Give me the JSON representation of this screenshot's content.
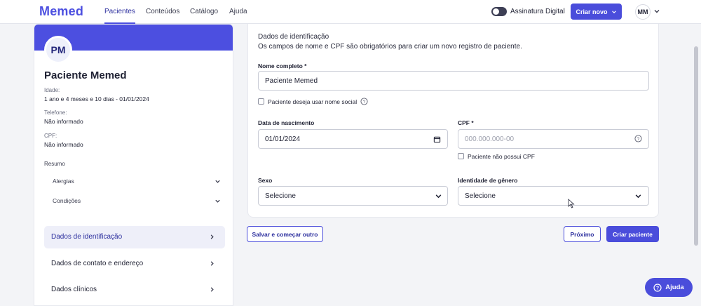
{
  "brand": {
    "logo_text": "Memed"
  },
  "nav": {
    "tabs": [
      {
        "label": "Pacientes",
        "active": true
      },
      {
        "label": "Conteúdos",
        "active": false
      },
      {
        "label": "Catálogo",
        "active": false
      },
      {
        "label": "Ajuda",
        "active": false
      }
    ]
  },
  "header": {
    "signature_label": "Assinatura Digital",
    "create_new_label": "Criar novo",
    "user_initials": "MM"
  },
  "patient": {
    "initials": "PM",
    "name": "Paciente Memed",
    "age_label": "Idade:",
    "age_value": "1 ano e 4 meses e 10 dias - 01/01/2024",
    "phone_label": "Telefone:",
    "phone_value": "Não informado",
    "cpf_label": "CPF:",
    "cpf_value": "Não informado",
    "summary_label": "Resumo",
    "summary_items": [
      "Alergias",
      "Condições"
    ]
  },
  "sidebar": {
    "items": [
      {
        "label": "Dados de identificação",
        "active": true
      },
      {
        "label": "Dados de contato e endereço",
        "active": false
      },
      {
        "label": "Dados clínicos",
        "active": false
      }
    ]
  },
  "form": {
    "section_title": "Dados de identificação",
    "section_description": "Os campos de nome e CPF são obrigatórios para criar um novo registro de paciente.",
    "full_name_label": "Nome completo *",
    "full_name_value": "Paciente Memed",
    "social_name_label": "Paciente deseja usar nome social",
    "birth_date_label": "Data de nascimento",
    "birth_date_value": "01/01/2024",
    "cpf_label": "CPF *",
    "cpf_placeholder": "000.000.000-00",
    "no_cpf_label": "Paciente não possui CPF",
    "sex_label": "Sexo",
    "sex_value": "Selecione",
    "gender_label": "Identidade de gênero",
    "gender_value": "Selecione"
  },
  "actions": {
    "save_and_new": "Salvar e começar outro",
    "next": "Próximo",
    "create_patient": "Criar paciente"
  },
  "help": {
    "label": "Ajuda"
  },
  "colors": {
    "primary": "#4a4ddb",
    "banner": "#4c4fe0"
  }
}
